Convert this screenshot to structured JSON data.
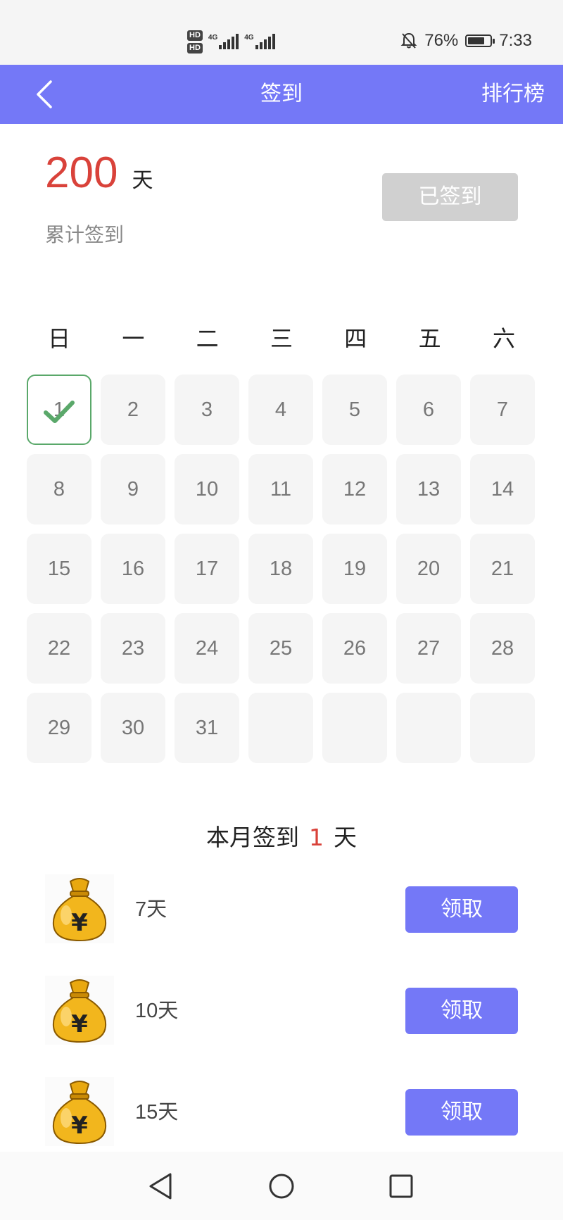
{
  "status_bar": {
    "hd1": "HD",
    "hd2": "HD",
    "net1": "4G",
    "net2": "4G",
    "battery_text": "76%",
    "battery_level": 0.76,
    "time": "7:33",
    "icons": [
      "mute-bell-icon",
      "battery-icon",
      "signal-icon"
    ]
  },
  "header": {
    "title": "签到",
    "rank_label": "排行榜",
    "back_icon": "chevron-left-icon",
    "color": "#7478f7"
  },
  "summary": {
    "total_days": "200",
    "total_unit": "天",
    "total_label": "累计签到",
    "signed_button": "已签到"
  },
  "calendar": {
    "weekdays": [
      "日",
      "一",
      "二",
      "三",
      "四",
      "五",
      "六"
    ],
    "days": [
      "1",
      "2",
      "3",
      "4",
      "5",
      "6",
      "7",
      "8",
      "9",
      "10",
      "11",
      "12",
      "13",
      "14",
      "15",
      "16",
      "17",
      "18",
      "19",
      "20",
      "21",
      "22",
      "23",
      "24",
      "25",
      "26",
      "27",
      "28",
      "29",
      "30",
      "31",
      "",
      "",
      "",
      ""
    ],
    "signed_days": [
      "1"
    ],
    "accent_check_color": "#5aa86a"
  },
  "monthly": {
    "prefix": "本月签到",
    "count": "1",
    "suffix": "天"
  },
  "rewards": [
    {
      "label": "7天",
      "button": "领取",
      "icon": "money-bag-icon"
    },
    {
      "label": "10天",
      "button": "领取",
      "icon": "money-bag-icon"
    },
    {
      "label": "15天",
      "button": "领取",
      "icon": "money-bag-icon"
    }
  ],
  "nav": {
    "icons": [
      "back-triangle-icon",
      "home-circle-icon",
      "recents-square-icon"
    ]
  }
}
